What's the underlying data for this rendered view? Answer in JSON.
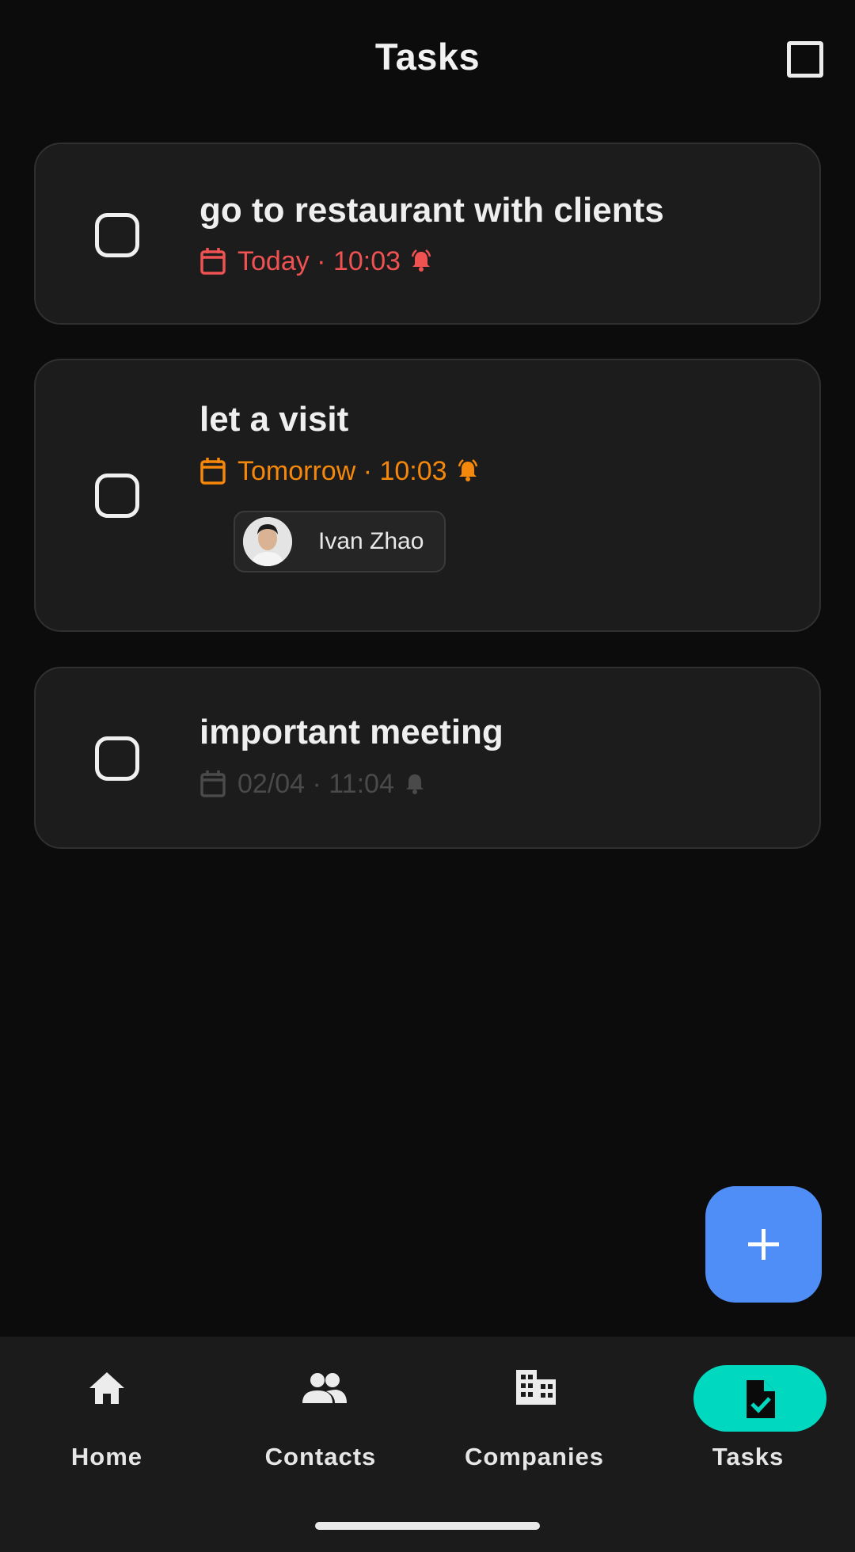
{
  "app_bar": {
    "title": "Tasks",
    "select_icon": "checkbox-outline-icon"
  },
  "tasks": [
    {
      "title": "go to restaurant with clients",
      "when": "Today · 10:03",
      "color": "#f05252",
      "has_alarm": true,
      "done": false
    },
    {
      "title": "let a visit",
      "when": "Tomorrow · 10:03",
      "color": "#f5870a",
      "has_alarm": true,
      "done": false,
      "contact": {
        "name": "Ivan Zhao",
        "avatar": "person-photo"
      }
    },
    {
      "title": "important meeting",
      "when": "02/04 · 11:04",
      "color": "#4a4a4b",
      "has_alarm": true,
      "done": false
    }
  ],
  "fab": {
    "icon": "plus-icon",
    "color": "#4f8ef7"
  },
  "bottom_nav": {
    "active_color": "#00d9c0",
    "items": [
      {
        "label": "Home",
        "icon": "home-icon"
      },
      {
        "label": "Contacts",
        "icon": "people-icon"
      },
      {
        "label": "Companies",
        "icon": "building-icon"
      },
      {
        "label": "Tasks",
        "icon": "task-file-icon",
        "active": true
      }
    ]
  }
}
